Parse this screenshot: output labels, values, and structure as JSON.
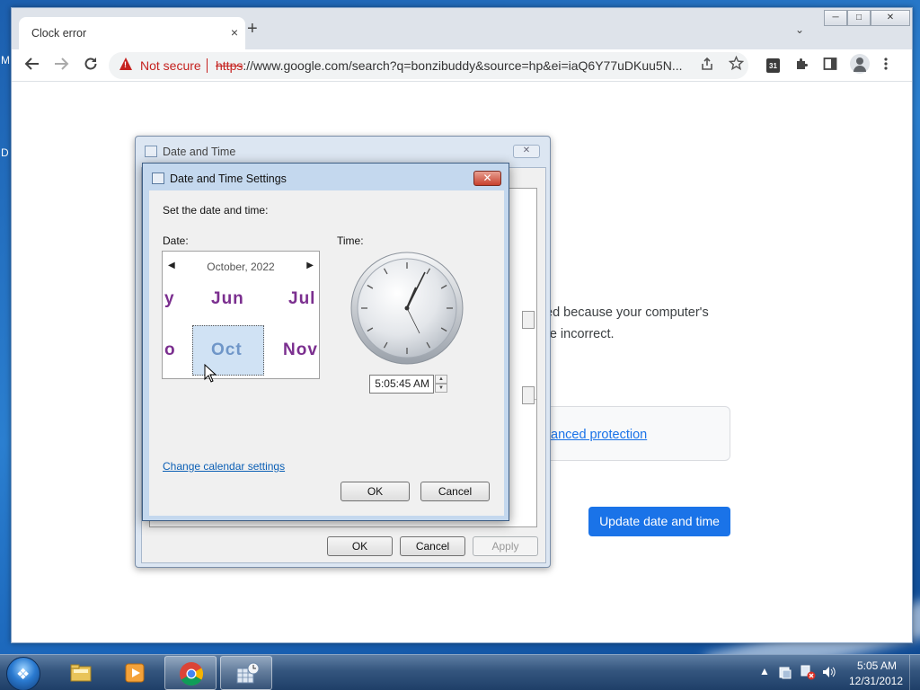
{
  "desktop": {
    "label_m": "M",
    "label_d": "D"
  },
  "browser": {
    "tab_title": "Clock error",
    "tab_close": "×",
    "new_tab": "+",
    "tab_menu": "⌄",
    "win_min": "─",
    "win_max": "□",
    "win_close": "✕",
    "omnibox": {
      "warning": "!",
      "not_secure": "Not secure",
      "url_scheme": "https",
      "url_rest": "://www.google.com/search?q=bonzibuddy&source=hp&ei=iaQ6Y77uDKuu5N..."
    },
    "calendar_ext_label": "31"
  },
  "page": {
    "msg_line1": "ed because your computer's",
    "msg_line2": "re incorrect.",
    "advanced_link": "anced protection",
    "update_button": "Update date and time"
  },
  "dt_window": {
    "title": "Date and Time",
    "close": "✕",
    "ok": "OK",
    "cancel": "Cancel",
    "apply": "Apply"
  },
  "settings": {
    "title": "Date and Time Settings",
    "close": "✕",
    "set_label": "Set the date and time:",
    "date_label": "Date:",
    "time_label": "Time:",
    "calendar": {
      "header": "October, 2022",
      "prev": "◀",
      "next": "▶",
      "months": [
        "y",
        "Jun",
        "Jul",
        "o",
        "Oct",
        "Nov"
      ],
      "selected_month": "Oct"
    },
    "time_value": "5:05:45 AM",
    "spin_up": "▲",
    "spin_down": "▼",
    "change_calendar_link": "Change calendar settings",
    "ok": "OK",
    "cancel": "Cancel"
  },
  "taskbar": {
    "tray_arrow": "▲",
    "clock_time": "5:05 AM",
    "clock_date": "12/31/2012"
  }
}
